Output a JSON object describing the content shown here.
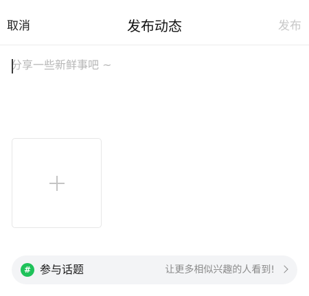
{
  "nav": {
    "cancel_label": "取消",
    "title": "发布动态",
    "publish_label": "发布"
  },
  "composer": {
    "placeholder": "分享一些新鲜事吧 ~",
    "value": ""
  },
  "media": {
    "add_icon": "plus-icon"
  },
  "topic": {
    "icon": "hashtag-icon",
    "icon_glyph": "#",
    "label": "参与话题",
    "hint": "让更多相似兴趣的人看到!",
    "accent_color": "#1fc25a"
  },
  "colors": {
    "disabled_text": "#c8c8c8",
    "placeholder_text": "#b7b7b7"
  }
}
